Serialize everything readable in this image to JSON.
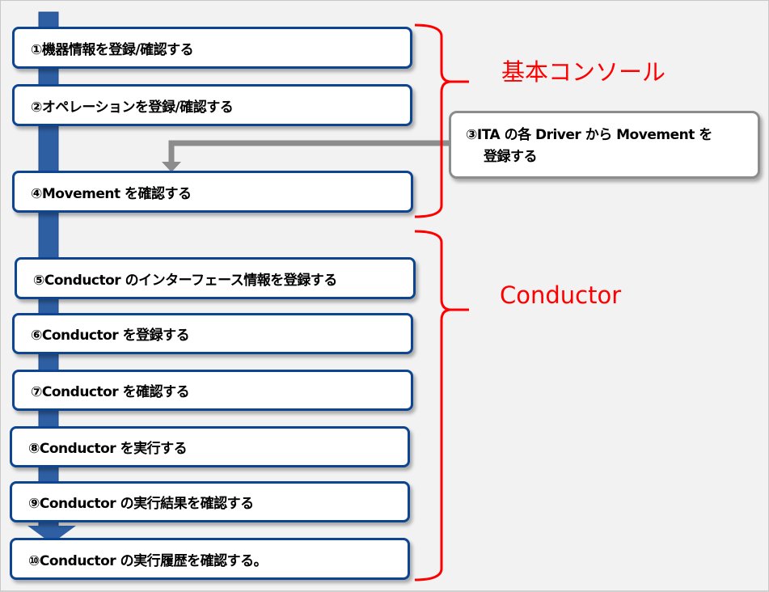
{
  "steps": [
    "①機器情報を登録/確認する",
    "②オペレーションを登録/確認する",
    "④Movement を確認する",
    "⑤Conductor のインターフェース情報を登録する",
    "⑥Conductor を登録する",
    "⑦Conductor を確認する",
    "⑧Conductor を実行する",
    "⑨Conductor の実行結果を確認する",
    "⑩Conductor の実行履歴を確認する。"
  ],
  "side_step": {
    "line1": "③ITA の各 Driver から Movement を",
    "line2": "登録する"
  },
  "groups": {
    "basic_console": "基本コンソール",
    "conductor": "Conductor"
  },
  "colors": {
    "step_border": "#0d4591",
    "spine": "#2e5fa3",
    "bracket": "#ff0000",
    "side_border": "#8c8c8c",
    "arrow": "#8c8c8c"
  }
}
